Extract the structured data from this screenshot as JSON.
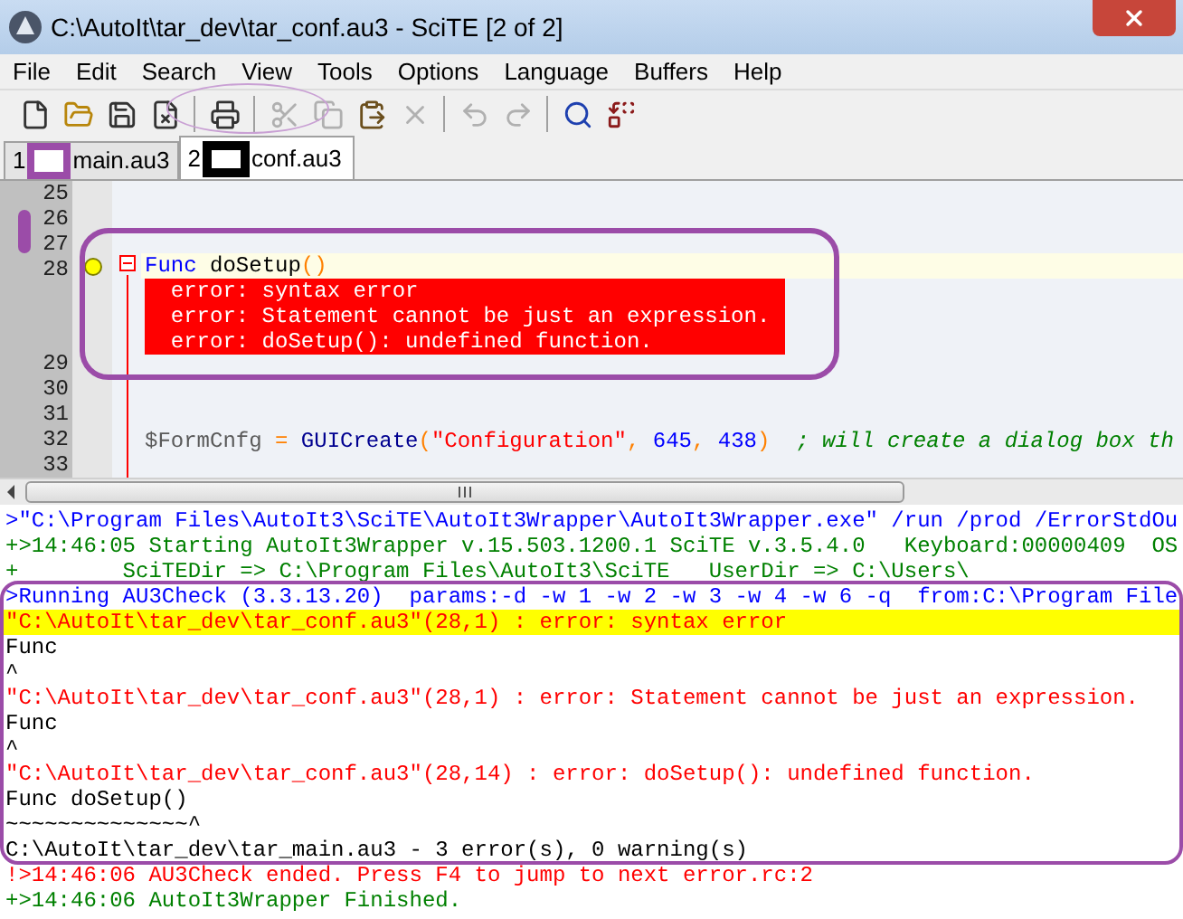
{
  "window": {
    "title": "C:\\AutoIt\\tar_dev\\tar_conf.au3 - SciTE [2 of 2]"
  },
  "menu": [
    {
      "label": "File"
    },
    {
      "label": "Edit"
    },
    {
      "label": "Search"
    },
    {
      "label": "View"
    },
    {
      "label": "Tools"
    },
    {
      "label": "Options"
    },
    {
      "label": "Language"
    },
    {
      "label": "Buffers"
    },
    {
      "label": "Help"
    }
  ],
  "toolbar": [
    {
      "buttons": [
        {
          "disabled": false
        },
        {
          "disabled": false
        },
        {
          "disabled": false
        },
        {
          "disabled": false
        }
      ]
    },
    {
      "buttons": [
        {
          "disabled": false
        }
      ]
    },
    {
      "buttons": [
        {
          "disabled": true
        },
        {
          "disabled": true
        },
        {
          "disabled": false
        },
        {
          "disabled": true
        }
      ]
    },
    {
      "buttons": [
        {
          "disabled": true
        },
        {
          "disabled": true
        }
      ]
    },
    {
      "buttons": [
        {
          "disabled": false
        },
        {
          "disabled": false
        }
      ]
    }
  ],
  "tabs": [
    {
      "number": "1",
      "label": "main.au3",
      "selected": false
    },
    {
      "number": "2",
      "label": "conf.au3",
      "selected": true
    }
  ],
  "editor": {
    "lines": [
      {
        "number": "25",
        "current": false,
        "bookmark": false,
        "fold_header": false
      },
      {
        "number": "26",
        "current": false,
        "bookmark": false,
        "fold_header": false
      },
      {
        "number": "27",
        "current": false,
        "bookmark": false,
        "fold_header": false
      },
      {
        "number": "28",
        "current": true,
        "bookmark": true,
        "fold_header": true,
        "tokens": [
          {
            "kind": "keyword",
            "text": "Func"
          },
          {
            "kind": "text",
            "text": " doSetup"
          },
          {
            "kind": "operator",
            "text": "()"
          }
        ],
        "annotations": [
          "  error: syntax error",
          "  error: Statement cannot be just an expression.",
          "  error: doSetup(): undefined function."
        ]
      },
      {
        "number": "29",
        "current": false,
        "bookmark": false,
        "fold_header": false
      },
      {
        "number": "30",
        "current": false,
        "bookmark": false,
        "fold_header": false
      },
      {
        "number": "31",
        "current": false,
        "bookmark": false,
        "fold_header": false
      },
      {
        "number": "32",
        "current": false,
        "bookmark": false,
        "fold_header": false,
        "tokens": [
          {
            "kind": "variable",
            "text": "$FormCnfg"
          },
          {
            "kind": "operator",
            "text": " = "
          },
          {
            "kind": "function",
            "text": "GUICreate"
          },
          {
            "kind": "operator",
            "text": "("
          },
          {
            "kind": "string",
            "text": "\"Configuration\""
          },
          {
            "kind": "operator",
            "text": ", "
          },
          {
            "kind": "number",
            "text": "645"
          },
          {
            "kind": "operator",
            "text": ", "
          },
          {
            "kind": "number",
            "text": "438"
          },
          {
            "kind": "operator",
            "text": ")"
          },
          {
            "kind": "comment",
            "text": "  ; will create a dialog box th"
          }
        ]
      },
      {
        "number": "33",
        "current": false,
        "bookmark": false,
        "fold_header": false
      }
    ]
  },
  "output": [
    {
      "kind": "command",
      "selected": false,
      "text": ">\"C:\\Program Files\\AutoIt3\\SciTE\\AutoIt3Wrapper\\AutoIt3Wrapper.exe\" /run /prod /ErrorStdOu"
    },
    {
      "kind": "info",
      "selected": false,
      "text": "+>14:46:05 Starting AutoIt3Wrapper v.15.503.1200.1 SciTE v.3.5.4.0   Keyboard:00000409  OS"
    },
    {
      "kind": "info",
      "selected": false,
      "text": "+        SciTEDir => C:\\Program Files\\AutoIt3\\SciTE   UserDir => C:\\Users\\"
    },
    {
      "kind": "command",
      "selected": false,
      "text": ">Running AU3Check (3.3.13.20)  params:-d -w 1 -w 2 -w 3 -w 4 -w 6 -q  from:C:\\Program File"
    },
    {
      "kind": "error",
      "selected": true,
      "text": "\"C:\\AutoIt\\tar_dev\\tar_conf.au3\"(28,1) : error: syntax error"
    },
    {
      "kind": "plain",
      "selected": false,
      "text": "Func"
    },
    {
      "kind": "plain",
      "selected": false,
      "text": "^"
    },
    {
      "kind": "error",
      "selected": false,
      "text": "\"C:\\AutoIt\\tar_dev\\tar_conf.au3\"(28,1) : error: Statement cannot be just an expression."
    },
    {
      "kind": "plain",
      "selected": false,
      "text": "Func"
    },
    {
      "kind": "plain",
      "selected": false,
      "text": "^"
    },
    {
      "kind": "error",
      "selected": false,
      "text": "\"C:\\AutoIt\\tar_dev\\tar_conf.au3\"(28,14) : error: doSetup(): undefined function."
    },
    {
      "kind": "plain",
      "selected": false,
      "text": "Func doSetup()"
    },
    {
      "kind": "plain",
      "selected": false,
      "text": "~~~~~~~~~~~~~~^"
    },
    {
      "kind": "plain",
      "selected": false,
      "text": "C:\\AutoIt\\tar_dev\\tar_main.au3 - 3 error(s), 0 warning(s)"
    },
    {
      "kind": "error",
      "selected": false,
      "text": "!>14:46:06 AU3Check ended. Press F4 to jump to next error.rc:2"
    },
    {
      "kind": "info",
      "selected": false,
      "text": "+>14:46:06 AutoIt3Wrapper Finished."
    }
  ]
}
